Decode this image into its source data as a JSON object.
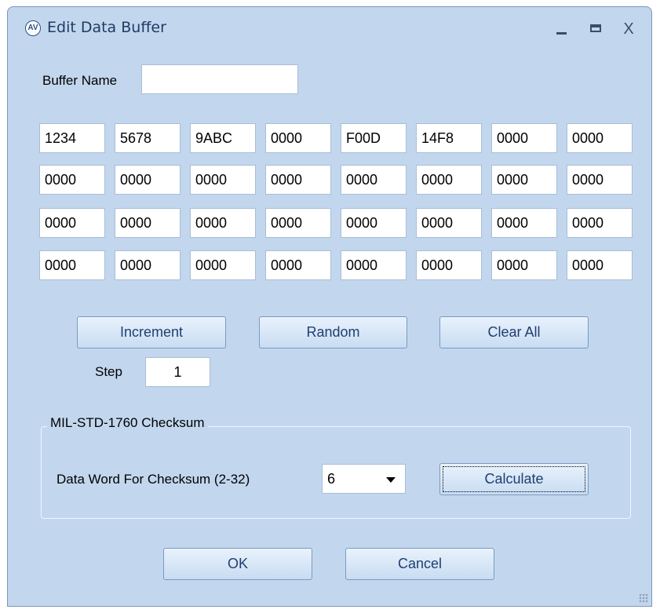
{
  "window": {
    "title": "Edit Data Buffer",
    "app_icon": "AV",
    "minimize_icon": "minimize-icon",
    "maximize_icon": "maximize-icon",
    "close_glyph": "X"
  },
  "buffer_name": {
    "label": "Buffer Name",
    "value": ""
  },
  "data_words": [
    [
      "1234",
      "5678",
      "9ABC",
      "0000",
      "F00D",
      "14F8",
      "0000",
      "0000"
    ],
    [
      "0000",
      "0000",
      "0000",
      "0000",
      "0000",
      "0000",
      "0000",
      "0000"
    ],
    [
      "0000",
      "0000",
      "0000",
      "0000",
      "0000",
      "0000",
      "0000",
      "0000"
    ],
    [
      "0000",
      "0000",
      "0000",
      "0000",
      "0000",
      "0000",
      "0000",
      "0000"
    ]
  ],
  "actions": {
    "increment": "Increment",
    "random": "Random",
    "clear_all": "Clear All"
  },
  "step": {
    "label": "Step",
    "value": "1"
  },
  "checksum": {
    "group_title": "MIL-STD-1760 Checksum",
    "word_label": "Data Word For Checksum (2-32)",
    "word_value": "6",
    "calculate": "Calculate"
  },
  "dialog": {
    "ok": "OK",
    "cancel": "Cancel"
  }
}
